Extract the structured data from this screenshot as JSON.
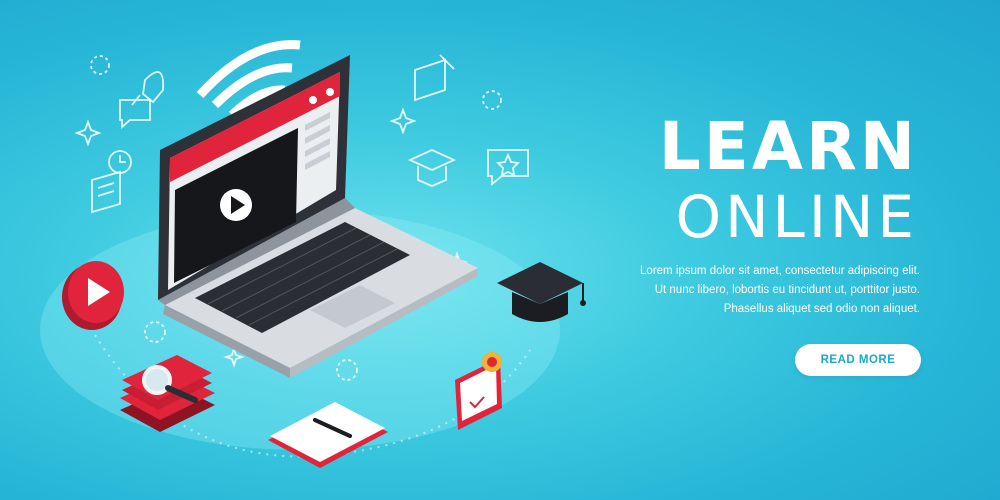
{
  "hero": {
    "title_line1": "LEARN",
    "title_line2": "ONLINE",
    "description_lines": [
      "Lorem ipsum dolor sit amet, consectetur adipiscing elit.",
      "Ut nunc libero, lobortis eu tincidunt ut, porttitor justo.",
      "Phasellus aliquet sed odio non aliquet."
    ],
    "cta_label": "READ MORE"
  },
  "colors": {
    "background": "#2bbbd9",
    "accent_red": "#e0243c",
    "text": "#ffffff",
    "button_text": "#1aa9cf"
  },
  "icons": [
    "wifi-icon",
    "rocket-icon",
    "chat-icon",
    "clock-icon",
    "clipboard-icon",
    "notepad-pencil-icon",
    "graduation-cap-icon",
    "chat-star-icon",
    "sparkle-icon",
    "dashed-circle-icon",
    "play-icon",
    "magnifier-icon",
    "certificate-icon",
    "pen-icon"
  ]
}
